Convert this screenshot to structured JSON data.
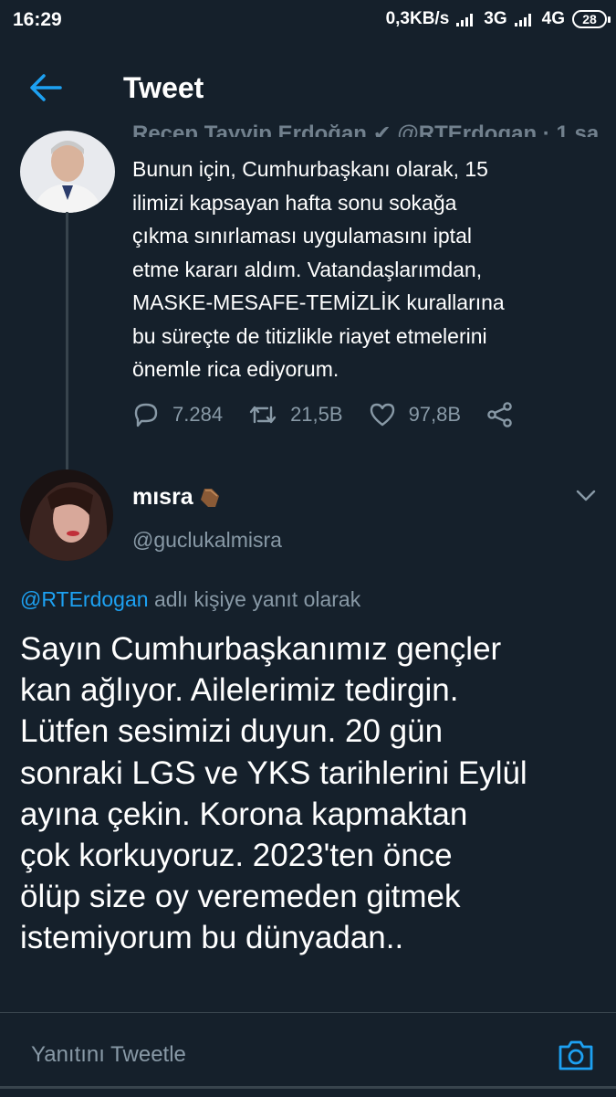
{
  "status_bar": {
    "time": "16:29",
    "speed": "0,3KB/s",
    "network1": "3G",
    "network2": "4G",
    "battery": "28"
  },
  "app_bar": {
    "title": "Tweet"
  },
  "parent_tweet": {
    "header": "Recep Tayyip Erdoğan ✔ @RTErdogan · 1 sa",
    "lines": [
      "Bunun için, Cumhurbaşkanı olarak, 15",
      "ilimizi kapsayan hafta sonu sokağa",
      "çıkma sınırlaması uygulamasını iptal",
      "etme kararı aldım. Vatandaşlarımdan,",
      "MASKE-MESAFE-TEMİZLİK kurallarına",
      "bu süreçte de titizlikle riayet etmelerini",
      "önemle rica ediyorum."
    ],
    "replies": "7.284",
    "retweets": "21,5B",
    "likes": "97,8B"
  },
  "reply_tweet": {
    "name": "mısra",
    "emoji": "⚰️",
    "handle": "@guclukalmisra",
    "replying_mention": "@RTErdogan",
    "replying_suffix": " adlı kişiye yanıt olarak",
    "lines": [
      "Sayın Cumhurbaşkanımız gençler",
      "kan ağlıyor. Ailelerimiz tedirgin.",
      "Lütfen sesimizi duyun. 20 gün",
      "sonraki LGS ve YKS tarihlerini Eylül",
      "ayına çekin. Korona kapmaktan",
      "çok korkuyoruz. 2023'ten önce",
      "ölüp size oy veremeden gitmek",
      "istemiyorum bu dünyadan.."
    ]
  },
  "compose": {
    "placeholder": "Yanıtını Tweetle"
  },
  "colors": {
    "background": "#15202b",
    "accent": "#1da1f2",
    "secondary_text": "#8899a6",
    "divider": "#38444d"
  },
  "icons": [
    "back-arrow-icon",
    "reply-icon",
    "retweet-icon",
    "like-icon",
    "share-icon",
    "chevron-down-icon",
    "camera-icon",
    "verified-badge-icon"
  ]
}
